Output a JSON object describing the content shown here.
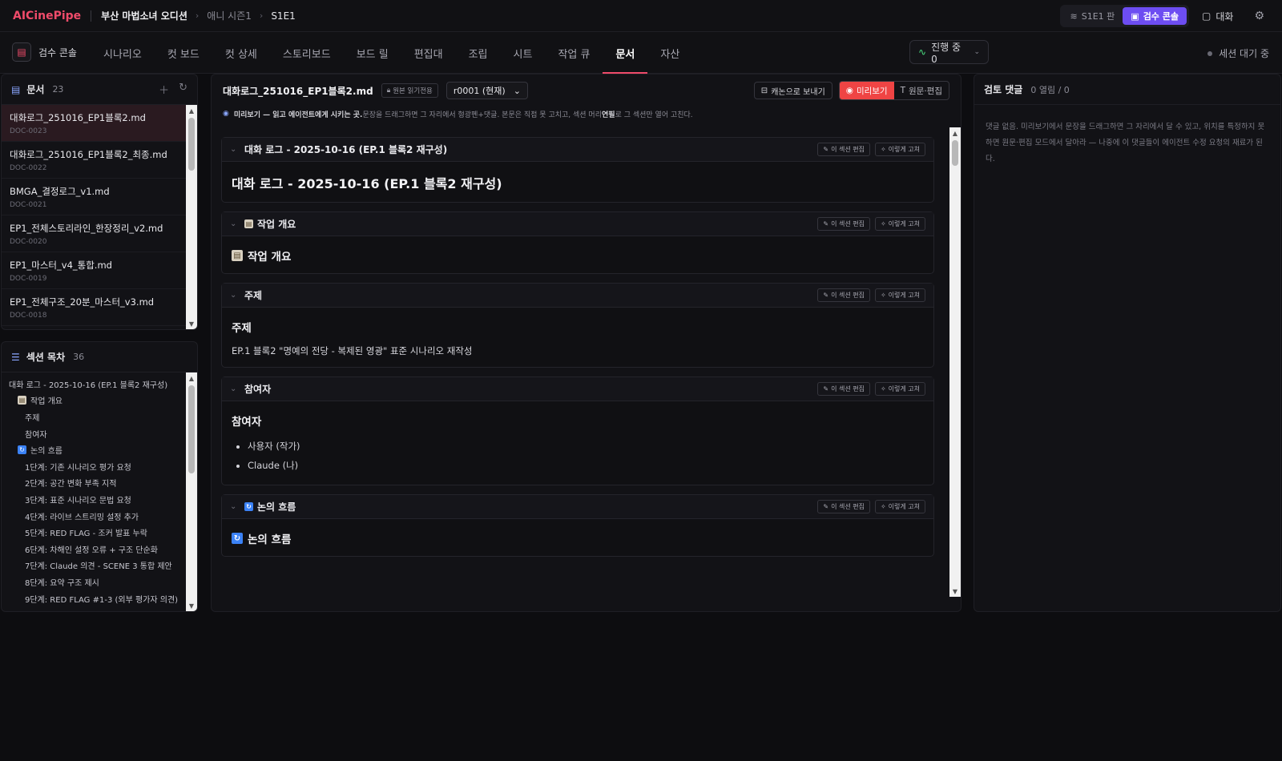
{
  "topbar": {
    "brand": "AICinePipe",
    "project": "부산 마법소녀 오디션",
    "breadcrumb": [
      "애니 시즌1",
      "S1E1"
    ],
    "plan_label": "S1E1 판",
    "console_label": "검수 콘솔",
    "chat_label": "대화"
  },
  "nav": {
    "console_label": "검수 콘솔",
    "tabs": [
      "시나리오",
      "컷 보드",
      "컷 상세",
      "스토리보드",
      "보드 릴",
      "편집대",
      "조립",
      "시트",
      "작업 큐",
      "문서",
      "자산"
    ],
    "active_tab": "문서",
    "progress_label": "진행 중 0",
    "session_status": "세션 대기 중"
  },
  "documents": {
    "title": "문서",
    "count": "23",
    "items": [
      {
        "name": "대화로그_251016_EP1블록2.md",
        "id": "DOC-0023"
      },
      {
        "name": "대화로그_251016_EP1블록2_최종.md",
        "id": "DOC-0022"
      },
      {
        "name": "BMGA_결정로그_v1.md",
        "id": "DOC-0021"
      },
      {
        "name": "EP1_전체스토리라인_한장정리_v2.md",
        "id": "DOC-0020"
      },
      {
        "name": "EP1_마스터_v4_통합.md",
        "id": "DOC-0019"
      },
      {
        "name": "EP1_전체구조_20분_마스터_v3.md",
        "id": "DOC-0018"
      }
    ]
  },
  "toc": {
    "title": "섹션 목차",
    "count": "36",
    "items": [
      "대화 로그 - 2025-10-16 (EP.1 블록2 재구성)",
      "작업 개요",
      "주제",
      "참여자",
      "논의 흐름",
      "1단계: 기존 시나리오 평가 요청",
      "2단계: 공간 변화 부족 지적",
      "3단계: 표준 시나리오 문법 요청",
      "4단계: 라이브 스트리밍 설정 추가",
      "5단계: RED FLAG - 조커 발표 누락",
      "6단계: 차해인 설정 오류 + 구조 단순화",
      "7단계: Claude 의견 - SCENE 3 통합 제안",
      "8단계: 요약 구조 제시",
      "9단계: RED FLAG #1-3 (외부 평가자 의견)"
    ]
  },
  "viewer": {
    "filename": "대화로그_251016_EP1블록2.md",
    "readonly_badge": "원본 읽기전용",
    "revision": "r0001 (현재)",
    "send_canon": "캐논으로 보내기",
    "mode_preview": "미리보기",
    "mode_edit": "원문·편집",
    "hint_bold": "미리보기 — 읽고 에이전트에게 시키는 곳.",
    "hint_text": " 문장을 드래그하면 그 자리에서 형광펜+댓글. 본문은 직접 못 고치고, 섹션 머리 ",
    "hint_bold2": "연필",
    "hint_tail": "로 그 섹션만 열어 고친다.",
    "edit_section": "이 섹션 편집",
    "fix_like": "이렇게 고쳐",
    "sections": {
      "s1_title": "대화 로그 - 2025-10-16 (EP.1 블록2 재구성)",
      "s2_title": "작업 개요",
      "s3_title": "주제",
      "s3_text": "EP.1 블록2 \"명예의 전당 - 복제된 영광\" 표준 시나리오 재작성",
      "s4_title": "참여자",
      "s4_items": [
        "사용자 (작가)",
        "Claude (나)"
      ],
      "s5_title": "논의 흐름"
    }
  },
  "comments": {
    "title": "검토 댓글",
    "count": "0 열림 / 0",
    "empty_text": "댓글 없음. 미리보기에서 문장을 드래그하면 그 자리에서 달 수 있고, 위치를 특정하지 못하면 원문·편집 모드에서 달아라 — 나중에 이 댓글들이 에이전트 수정 요청의 재료가 된다."
  },
  "colors": {
    "brand": "#ef4b6a",
    "accent_purple": "#6d4df2",
    "preview_red": "#ef4444"
  }
}
